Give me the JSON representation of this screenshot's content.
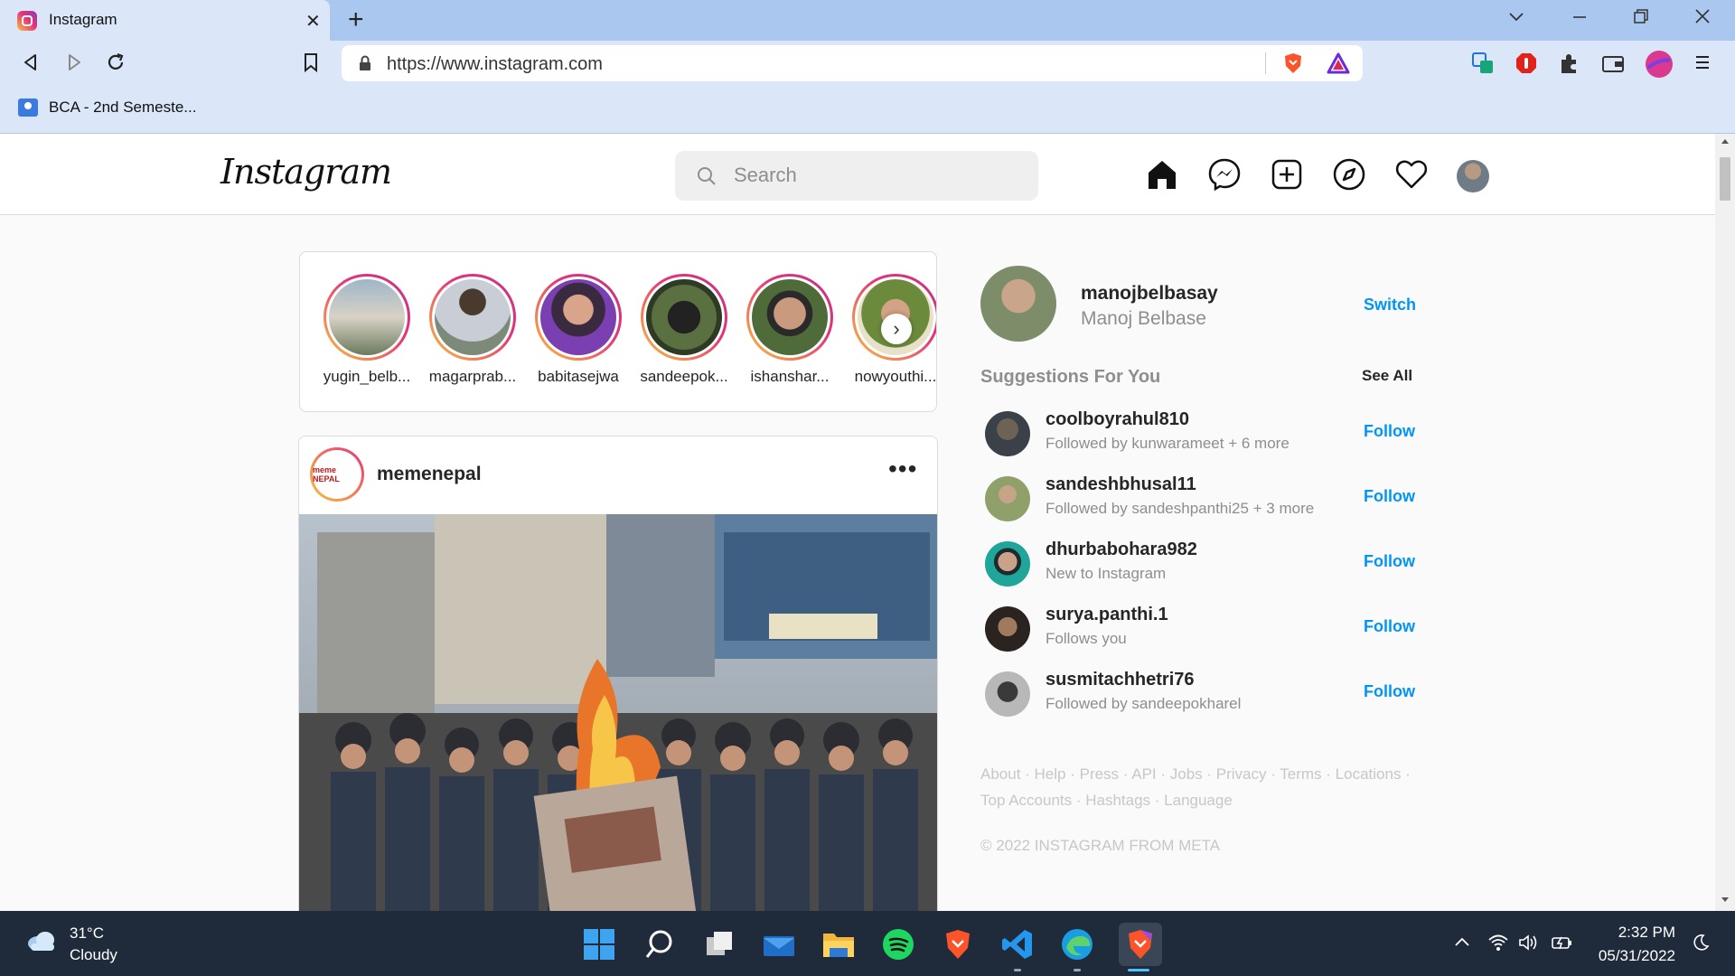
{
  "browser": {
    "tab_title": "Instagram",
    "url": "https://www.instagram.com",
    "bookmark_label": "BCA - 2nd Semeste..."
  },
  "instagram": {
    "logo_text": "Instagram",
    "search_placeholder": "Search",
    "stories": [
      {
        "name": "yugin_belb..."
      },
      {
        "name": "magarprab..."
      },
      {
        "name": "babitasejwa"
      },
      {
        "name": "sandeepok..."
      },
      {
        "name": "ishanshar..."
      },
      {
        "name": "nowyouthi..."
      }
    ],
    "post": {
      "username": "memenepal",
      "avatar_text": "meme NEPAL",
      "more_label": "•••"
    },
    "profile": {
      "username": "manojbelbasay",
      "full_name": "Manoj Belbase",
      "switch_label": "Switch"
    },
    "suggestions_title": "Suggestions For You",
    "see_all_label": "See All",
    "suggestions": [
      {
        "username": "coolboyrahul810",
        "subtitle": "Followed by kunwarameet + 6 more",
        "action": "Follow"
      },
      {
        "username": "sandeshbhusal11",
        "subtitle": "Followed by sandeshpanthi25 + 3 more",
        "action": "Follow"
      },
      {
        "username": "dhurbabohara982",
        "subtitle": "New to Instagram",
        "action": "Follow"
      },
      {
        "username": "surya.panthi.1",
        "subtitle": "Follows you",
        "action": "Follow"
      },
      {
        "username": "susmitachhetri76",
        "subtitle": "Followed by sandeepokharel",
        "action": "Follow"
      }
    ],
    "footer_links_line1": "About · Help · Press · API · Jobs · Privacy · Terms · Locations ·",
    "footer_links_line2": "Top Accounts · Hashtags · Language",
    "copyright": "© 2022 INSTAGRAM FROM META"
  },
  "taskbar": {
    "weather_temp": "31°C",
    "weather_desc": "Cloudy",
    "time": "2:32 PM",
    "date": "05/31/2022"
  },
  "colors": {
    "accent_blue": "#0095f6",
    "story_gradient_start": "#f9c23c",
    "story_gradient_end": "#c13584",
    "taskbar_bg": "#1f2b3a"
  }
}
